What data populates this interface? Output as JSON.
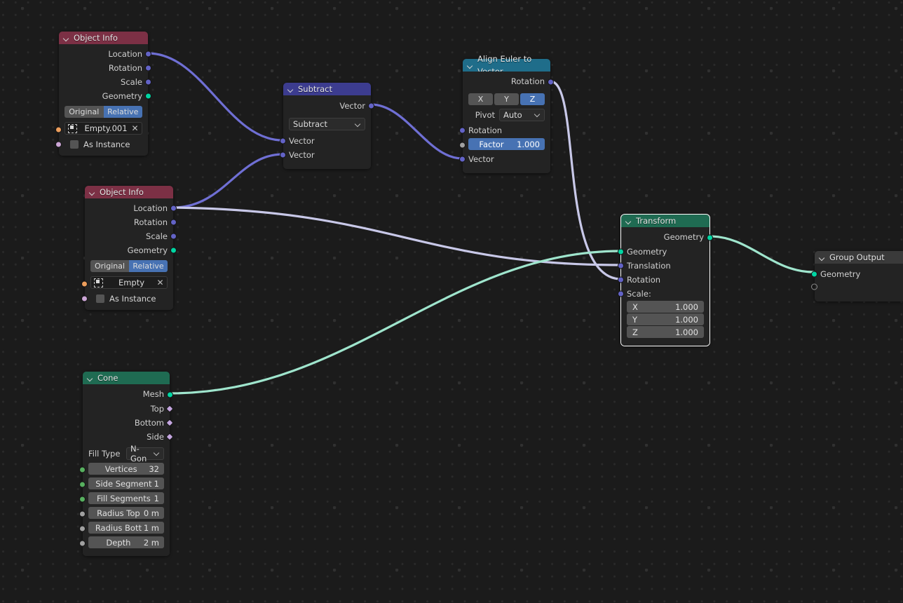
{
  "editor": {
    "name": "Blender Geometry Node Editor",
    "background": "#1b1b1b"
  },
  "colors": {
    "header_input": "#7c3045",
    "header_vector": "#3c3c8f",
    "header_converter": "#1f6d8a",
    "header_geometry": "#1f6b52",
    "header_group": "#3a3a3a",
    "socket_vector": "#6363c7",
    "socket_geometry": "#00d6a3",
    "socket_field": "#c4a6e0",
    "socket_float": "#a1a1a1",
    "socket_object": "#ed9e5c",
    "socket_bool": "#cca6d6",
    "noodle_vector": "#6f6fd4",
    "noodle_geometry": "#9fe5cd",
    "noodle_light": "#c8c8e8",
    "accent_blue": "#4772b3"
  },
  "nodes": {
    "object_info_1": {
      "title": "Object Info",
      "outputs": [
        "Location",
        "Rotation",
        "Scale",
        "Geometry"
      ],
      "toggle_original": "Original",
      "toggle_relative": "Relative",
      "object_value": "Empty.001",
      "clear_label": "✕",
      "as_instance_label": "As Instance"
    },
    "object_info_2": {
      "title": "Object Info",
      "outputs": [
        "Location",
        "Rotation",
        "Scale",
        "Geometry"
      ],
      "toggle_original": "Original",
      "toggle_relative": "Relative",
      "object_value": "Empty",
      "clear_label": "✕",
      "as_instance_label": "As Instance"
    },
    "subtract": {
      "title": "Subtract",
      "output": "Vector",
      "operation": "Subtract",
      "inputs": [
        "Vector",
        "Vector"
      ]
    },
    "align_euler": {
      "title": "Align Euler to Vector",
      "output": "Rotation",
      "axis_options": [
        "X",
        "Y",
        "Z"
      ],
      "axis_selected": "Z",
      "pivot_label": "Pivot",
      "pivot_value": "Auto",
      "input_rotation": "Rotation",
      "factor_label": "Factor",
      "factor_value": "1.000",
      "input_vector": "Vector"
    },
    "transform": {
      "title": "Transform",
      "output": "Geometry",
      "inputs": [
        "Geometry",
        "Translation",
        "Rotation",
        "Scale:"
      ],
      "scale": [
        {
          "axis": "X",
          "value": "1.000"
        },
        {
          "axis": "Y",
          "value": "1.000"
        },
        {
          "axis": "Z",
          "value": "1.000"
        }
      ],
      "selected": true
    },
    "group_output": {
      "title": "Group Output",
      "input": "Geometry"
    },
    "cone": {
      "title": "Cone",
      "outputs": [
        "Mesh",
        "Top",
        "Bottom",
        "Side"
      ],
      "fill_type_label": "Fill Type",
      "fill_type_value": "N-Gon",
      "params": [
        {
          "name": "Vertices",
          "value": "32"
        },
        {
          "name": "Side Segment",
          "value": "1"
        },
        {
          "name": "Fill Segments",
          "value": "1"
        },
        {
          "name": "Radius Top",
          "value": "0 m"
        },
        {
          "name": "Radius Bott",
          "value": "1 m"
        },
        {
          "name": "Depth",
          "value": "2 m"
        }
      ]
    }
  }
}
